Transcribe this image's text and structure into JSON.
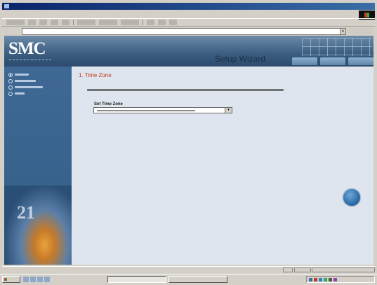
{
  "window": {
    "title": ""
  },
  "menu": {
    "items": [
      "",
      "",
      "",
      "",
      "",
      ""
    ]
  },
  "address": {
    "label": "",
    "url": "",
    "go_label": ""
  },
  "banner": {
    "logo": "SMC",
    "title": "Setup Wizard"
  },
  "sidebar": {
    "items": [
      {
        "label": "",
        "selected": true
      },
      {
        "label": "",
        "selected": false
      },
      {
        "label": "",
        "selected": false
      },
      {
        "label": "",
        "selected": false
      }
    ]
  },
  "content": {
    "heading": "1. Time Zone",
    "description": "",
    "field_label": "Set Time Zone",
    "selected_value": ""
  },
  "status": {
    "text": "",
    "zone": ""
  },
  "taskbar": {
    "start_label": "",
    "tasks": [
      "",
      ""
    ],
    "clock": ""
  },
  "colors": {
    "heading": "#c43a1a",
    "sidebar": "#3f6994",
    "banner": "#3c5f82",
    "content_bg": "#dfe5ee"
  }
}
